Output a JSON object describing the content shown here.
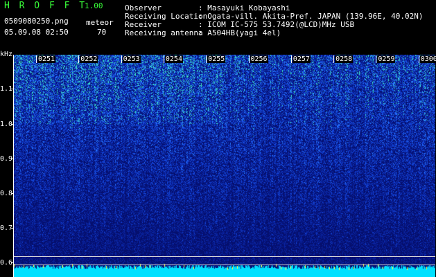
{
  "app": {
    "title": "H R O F F T",
    "version": "1.00"
  },
  "file": {
    "name": "0509080250.png",
    "datetime": "05.09.08 02:50"
  },
  "detection": {
    "label": "meteor",
    "count": "70"
  },
  "info": [
    {
      "label": "Observer",
      "value": ": Masayuki Kobayashi"
    },
    {
      "label": "Receiving Location",
      "value": ": Ogata-vill. Akita-Pref. JAPAN (139.96E, 40.02N)"
    },
    {
      "label": "Receiver",
      "value": ": ICOM IC-575 53.7492(@LCD)MHz USB"
    },
    {
      "label": "Receiving antenna",
      "value": ": A504HB(yagi 4el)"
    }
  ],
  "axis": {
    "unit": "kHz",
    "time_labels": [
      "0251",
      "0252",
      "0253",
      "0254",
      "0255",
      "0256",
      "0257",
      "0258",
      "0259",
      "0300"
    ],
    "freq_labels": [
      "1.1",
      "1.0",
      "0.9",
      "0.8",
      "0.7",
      "0.6"
    ]
  },
  "colors": {
    "header_green": "#39ff39",
    "spectrum_low": "#0a1a8c",
    "spectrum_mid": "#2f6bff",
    "spectrum_high": "#30e0c0",
    "baseline": "#00e0ff"
  }
}
